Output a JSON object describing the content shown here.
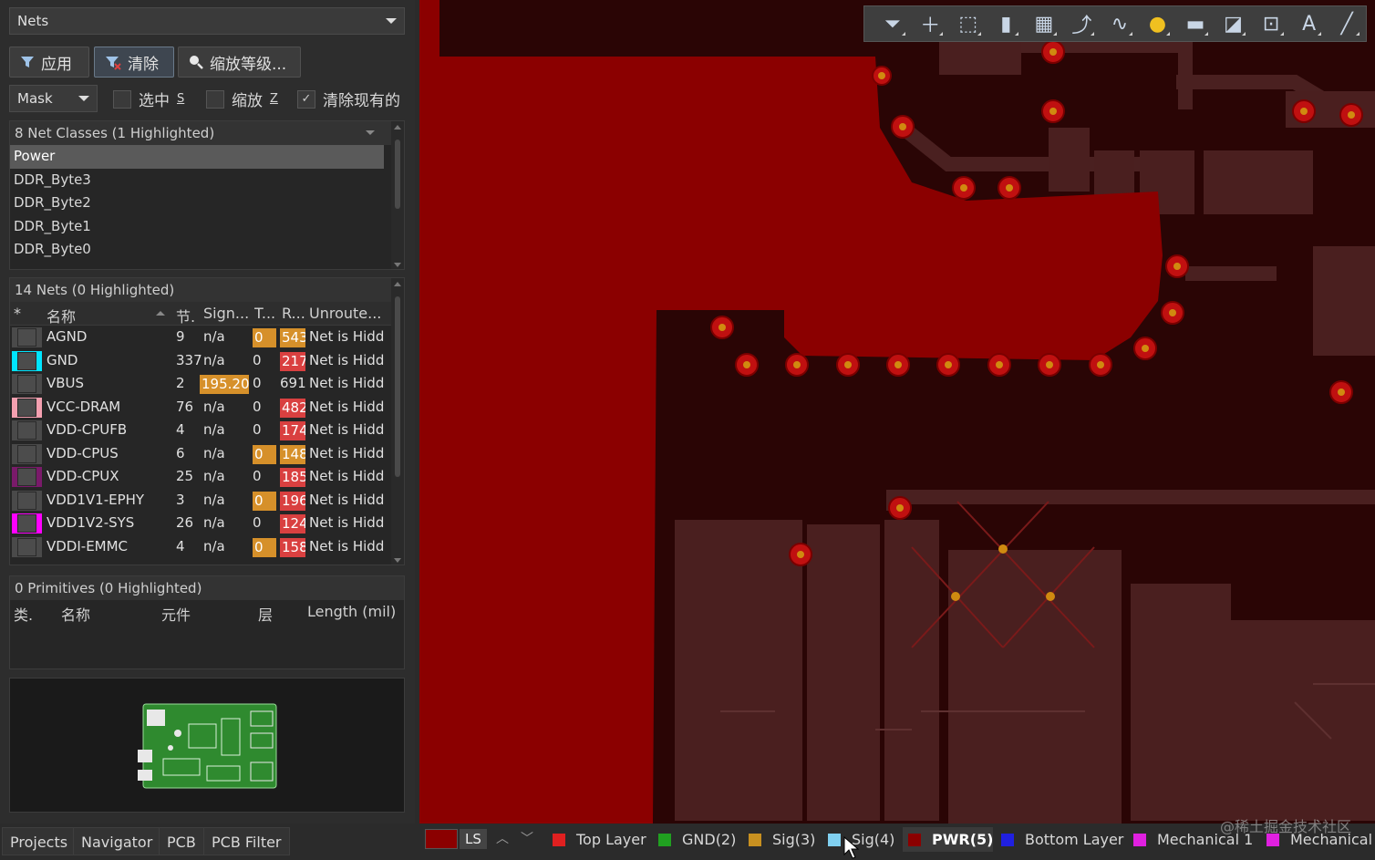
{
  "panel": {
    "mode_dropdown": "Nets",
    "buttons": {
      "apply": "应用",
      "clear": "清除",
      "zoom_level": "缩放等级..."
    },
    "mask_dropdown": "Mask",
    "checkboxes": [
      {
        "label": "选中",
        "key": "S",
        "checked": false
      },
      {
        "label": "缩放",
        "key": "Z",
        "checked": false
      },
      {
        "label": "清除现有的",
        "key": "",
        "checked": true
      }
    ]
  },
  "net_classes": {
    "header": "8 Net Classes (1 Highlighted)",
    "items": [
      "Power",
      "DDR_Byte3",
      "DDR_Byte2",
      "DDR_Byte1",
      "DDR_Byte0"
    ],
    "selected": "Power"
  },
  "nets": {
    "header": "14 Nets (0 Highlighted)",
    "columns": [
      "*",
      "名称",
      "节.",
      "Sign...",
      "T...",
      "R...",
      "Unroute..."
    ],
    "rows": [
      {
        "name": "AGND",
        "nodes": "9",
        "signal": "n/a",
        "t": "0",
        "r": "543",
        "unrouted": "Net is Hidden",
        "color": "#4a4a4a",
        "t_hl": true,
        "r_hl": "orange"
      },
      {
        "name": "GND",
        "nodes": "337",
        "signal": "n/a",
        "t": "0",
        "r": "217",
        "unrouted": "Net is Hidden",
        "color": "#00e5ff",
        "t_hl": false,
        "r_hl": "red"
      },
      {
        "name": "VBUS",
        "nodes": "2",
        "signal": "195.20",
        "t": "0",
        "r": "691",
        "unrouted": "Net is Hidden",
        "color": "#4a4a4a",
        "t_hl": false,
        "r_hl": "",
        "signal_hl": true
      },
      {
        "name": "VCC-DRAM",
        "nodes": "76",
        "signal": "n/a",
        "t": "0",
        "r": "482",
        "unrouted": "Net is Hidden",
        "color": "#f4a0b0",
        "t_hl": false,
        "r_hl": "red"
      },
      {
        "name": "VDD-CPUFB",
        "nodes": "4",
        "signal": "n/a",
        "t": "0",
        "r": "174",
        "unrouted": "Net is Hidden",
        "color": "#4a4a4a",
        "t_hl": false,
        "r_hl": "red"
      },
      {
        "name": "VDD-CPUS",
        "nodes": "6",
        "signal": "n/a",
        "t": "0",
        "r": "148",
        "unrouted": "Net is Hidden",
        "color": "#4a4a4a",
        "t_hl": true,
        "r_hl": "orange"
      },
      {
        "name": "VDD-CPUX",
        "nodes": "25",
        "signal": "n/a",
        "t": "0",
        "r": "185",
        "unrouted": "Net is Hidden",
        "color": "#7a1a6a",
        "t_hl": false,
        "r_hl": "red"
      },
      {
        "name": "VDD1V1-EPHY",
        "nodes": "3",
        "signal": "n/a",
        "t": "0",
        "r": "196",
        "unrouted": "Net is Hidden",
        "color": "#4a4a4a",
        "t_hl": true,
        "r_hl": "red"
      },
      {
        "name": "VDD1V2-SYS",
        "nodes": "26",
        "signal": "n/a",
        "t": "0",
        "r": "124",
        "unrouted": "Net is Hidden",
        "color": "#ff00ff",
        "t_hl": false,
        "r_hl": "red"
      },
      {
        "name": "VDDI-EMMC",
        "nodes": "4",
        "signal": "n/a",
        "t": "0",
        "r": "158",
        "unrouted": "Net is Hidden",
        "color": "#4a4a4a",
        "t_hl": true,
        "r_hl": "red"
      }
    ]
  },
  "primitives": {
    "header": "0 Primitives (0 Highlighted)",
    "columns": [
      "类.",
      "名称",
      "元件",
      "层",
      "Length (mil)"
    ]
  },
  "bottom_tabs": [
    "Projects",
    "Navigator",
    "PCB",
    "PCB Filter"
  ],
  "layers": {
    "current": "LS",
    "items": [
      {
        "label": "Top Layer",
        "color": "#e02020"
      },
      {
        "label": "GND(2)",
        "color": "#20a020"
      },
      {
        "label": "Sig(3)",
        "color": "#c89020"
      },
      {
        "label": "Sig(4)",
        "color": "#80d0f0"
      },
      {
        "label": "PWR(5)",
        "color": "#8b0000",
        "active": true
      },
      {
        "label": "Bottom Layer",
        "color": "#2020e0"
      },
      {
        "label": "Mechanical 1",
        "color": "#e020e0"
      },
      {
        "label": "Mechanical",
        "color": "#e020e0"
      }
    ]
  },
  "toolbar_icons": [
    "filter-icon",
    "crosshair-icon",
    "select-rect-icon",
    "chart-icon",
    "component-icon",
    "route-icon",
    "diff-pair-icon",
    "via-icon",
    "polygon-icon",
    "keepout-icon",
    "graph-icon",
    "text-icon",
    "line-icon"
  ],
  "watermark": "@稀土掘金技术社区"
}
